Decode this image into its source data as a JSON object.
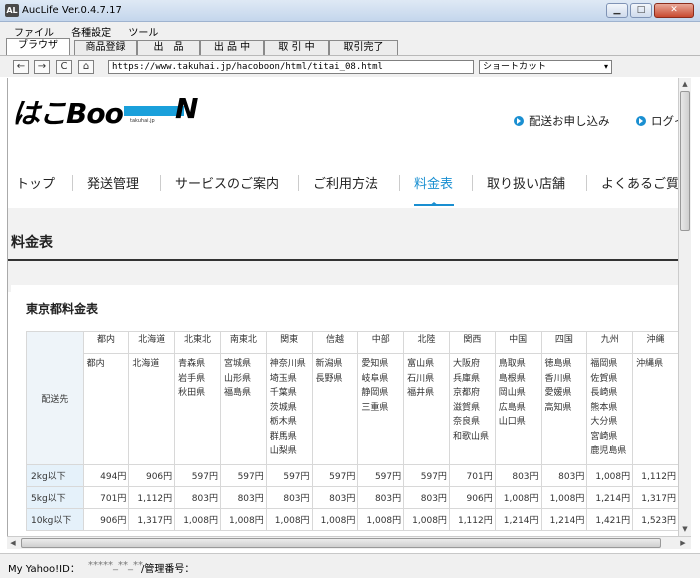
{
  "window": {
    "title": "AucLife Ver.0.4.7.17",
    "icon_label": "AL",
    "buttons": {
      "minimize": "▁",
      "maximize": "□",
      "close": "✕"
    }
  },
  "menu": [
    "ファイル",
    "各種設定",
    "ツール"
  ],
  "app_tabs": [
    "ブラウザ",
    "商品登録",
    "出　品",
    "出 品 中",
    "取 引 中",
    "取引完了"
  ],
  "toolbar": {
    "back": "←",
    "forward": "→",
    "reload": "C",
    "home": "⌂",
    "url": "https://www.takuhai.jp/hacoboon/html/titai_08.html",
    "shortcut": "ショートカット",
    "shortcut_arrow": "▾"
  },
  "site": {
    "logo": {
      "text": "はこBoo",
      "n": "N",
      "sub": "takuhai.jp"
    },
    "top_links": [
      "配送お申し込み",
      "ログイ"
    ],
    "gnav": [
      "トップ",
      "発送管理",
      "サービスのご案内",
      "ご利用方法",
      "料金表",
      "取り扱い店舗",
      "よくあるご質問"
    ],
    "page_title": "料金表",
    "card_title": "東京都料金表"
  },
  "rate_table": {
    "corner_label": "配送先",
    "regions": [
      "都内",
      "北海道",
      "北東北",
      "南東北",
      "関東",
      "信越",
      "中部",
      "北陸",
      "関西",
      "中国",
      "四国",
      "九州",
      "沖縄"
    ],
    "prefectures": [
      [
        "都内"
      ],
      [
        "北海道"
      ],
      [
        "青森県",
        "岩手県",
        "秋田県"
      ],
      [
        "宮城県",
        "山形県",
        "福島県"
      ],
      [
        "神奈川県",
        "埼玉県",
        "千葉県",
        "茨城県",
        "栃木県",
        "群馬県",
        "山梨県"
      ],
      [
        "新潟県",
        "長野県"
      ],
      [
        "愛知県",
        "岐阜県",
        "静岡県",
        "三重県"
      ],
      [
        "富山県",
        "石川県",
        "福井県"
      ],
      [
        "大阪府",
        "兵庫県",
        "京都府",
        "滋賀県",
        "奈良県",
        "和歌山県"
      ],
      [
        "鳥取県",
        "島根県",
        "岡山県",
        "広島県",
        "山口県"
      ],
      [
        "徳島県",
        "香川県",
        "愛媛県",
        "高知県"
      ],
      [
        "福岡県",
        "佐賀県",
        "長崎県",
        "熊本県",
        "大分県",
        "宮崎県",
        "鹿児島県"
      ],
      [
        "沖縄県"
      ]
    ],
    "rows": [
      {
        "label": "2kg以下",
        "prices": [
          "494円",
          "906円",
          "597円",
          "597円",
          "597円",
          "597円",
          "597円",
          "597円",
          "701円",
          "803円",
          "803円",
          "1,008円",
          "1,112円"
        ]
      },
      {
        "label": "5kg以下",
        "prices": [
          "701円",
          "1,112円",
          "803円",
          "803円",
          "803円",
          "803円",
          "803円",
          "803円",
          "906円",
          "1,008円",
          "1,008円",
          "1,214円",
          "1,317円"
        ]
      },
      {
        "label": "10kg以下",
        "prices": [
          "906円",
          "1,317円",
          "1,008円",
          "1,008円",
          "1,008円",
          "1,008円",
          "1,008円",
          "1,008円",
          "1,112円",
          "1,214円",
          "1,214円",
          "1,421円",
          "1,523円"
        ]
      }
    ]
  },
  "scroll": {
    "up": "▲",
    "down": "▼",
    "left": "◀",
    "right": "▶",
    "grip": "⦙"
  },
  "status": {
    "yahoo_label": "My Yahoo!ID：",
    "yahoo_value": "*****_**_**",
    "admin_label": "/管理番号："
  }
}
